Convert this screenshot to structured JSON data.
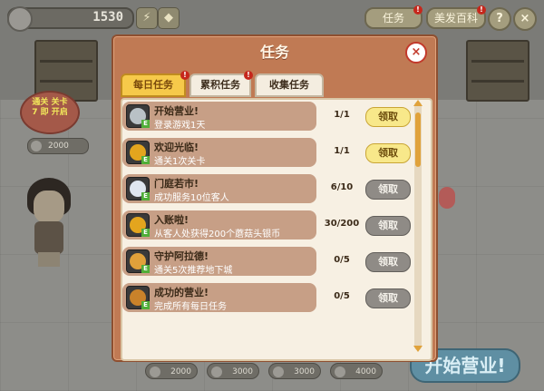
{
  "topbar": {
    "coins": "1530",
    "task_label": "任务",
    "gourmet_label": "美发百科",
    "help_label": "?",
    "close_label": "×"
  },
  "scene": {
    "speech_text": "通关 关卡 7 即 开启",
    "speech_price": "2000",
    "bottom_prices": [
      "2000",
      "3000",
      "3000",
      "4000"
    ],
    "start_button": "开始营业!"
  },
  "dialog": {
    "title": "任务",
    "close_label": "×",
    "tabs": [
      {
        "label": "每日任务",
        "active": true,
        "alert": true
      },
      {
        "label": "累积任务",
        "active": false,
        "alert": true
      },
      {
        "label": "收集任务",
        "active": false,
        "alert": false
      }
    ],
    "tasks": [
      {
        "name": "开始营业!",
        "desc": "登录游戏1天",
        "progress": "1/1",
        "button": "领取",
        "claimable": true,
        "icon": "clock-icon",
        "icon_color": "#b9c1c6"
      },
      {
        "name": "欢迎光临!",
        "desc": "通关1次关卡",
        "progress": "1/1",
        "button": "领取",
        "claimable": true,
        "icon": "gold-badge-icon",
        "icon_color": "#e3a51e"
      },
      {
        "name": "门庭若市!",
        "desc": "成功服务10位客人",
        "progress": "6/10",
        "button": "领取",
        "claimable": false,
        "icon": "sparkle-icon",
        "icon_color": "#dfe6ef"
      },
      {
        "name": "入账啦!",
        "desc": "从客人处获得200个蘑菇头银币",
        "progress": "30/200",
        "button": "领取",
        "claimable": false,
        "icon": "gold-badge-icon",
        "icon_color": "#e3a51e"
      },
      {
        "name": "守护阿拉德!",
        "desc": "通关5次推荐地下城",
        "progress": "0/5",
        "button": "领取",
        "claimable": false,
        "icon": "treasure-icon",
        "icon_color": "#e0a13a"
      },
      {
        "name": "成功的营业!",
        "desc": "完成所有每日任务",
        "progress": "0/5",
        "button": "领取",
        "claimable": false,
        "icon": "chest-icon",
        "icon_color": "#c9822a"
      }
    ]
  }
}
